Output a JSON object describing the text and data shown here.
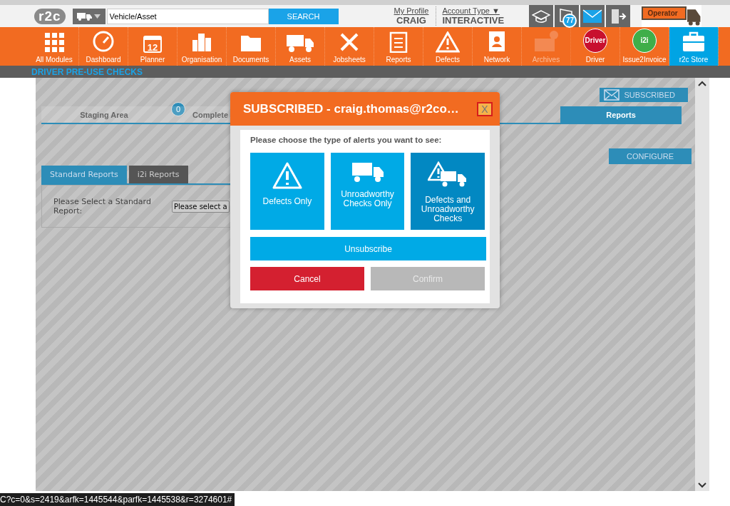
{
  "header": {
    "logo": "r2c",
    "search": {
      "value": "Vehicle/Asset",
      "button": "SEARCH"
    },
    "profile": {
      "link": "My Profile",
      "name": "CRAIG"
    },
    "account": {
      "link": "Account Type",
      "caret": "▼",
      "value": "INTERACTIVE"
    },
    "notification_count": "77",
    "operator": "Operator"
  },
  "nav": [
    {
      "label": "All Modules",
      "kind": "grid",
      "selected": false,
      "disabled": false
    },
    {
      "label": "Dashboard",
      "kind": "gauge",
      "selected": false,
      "disabled": false
    },
    {
      "label": "Planner",
      "kind": "calendar",
      "icon_text": "12",
      "selected": false,
      "disabled": false
    },
    {
      "label": "Organisation",
      "kind": "buildings",
      "selected": false,
      "disabled": false
    },
    {
      "label": "Documents",
      "kind": "folder",
      "selected": false,
      "disabled": false
    },
    {
      "label": "Assets",
      "kind": "truck",
      "selected": false,
      "disabled": false
    },
    {
      "label": "Jobsheets",
      "kind": "tools",
      "selected": false,
      "disabled": false
    },
    {
      "label": "Reports",
      "kind": "clipboard",
      "selected": false,
      "disabled": false
    },
    {
      "label": "Defects",
      "kind": "warning",
      "selected": false,
      "disabled": false
    },
    {
      "label": "Network",
      "kind": "contacts",
      "selected": false,
      "disabled": false
    },
    {
      "label": "Archives",
      "kind": "archive",
      "selected": false,
      "disabled": true
    },
    {
      "label": "Driver",
      "kind": "badge",
      "icon_text": "Driver",
      "color": "#c8102e",
      "selected": false,
      "disabled": false
    },
    {
      "label": "Issue2Invoice",
      "kind": "badge",
      "icon_text": "i2i",
      "color": "#3fae49",
      "selected": false,
      "disabled": false
    },
    {
      "label": "r2c Store",
      "kind": "briefcase",
      "selected": true,
      "disabled": false
    }
  ],
  "page_title": "DRIVER PRE-USE CHECKS",
  "subscribed_button": "SUBSCRIBED",
  "tabs": [
    {
      "label": "Staging Area",
      "badge": "0",
      "selected": false
    },
    {
      "label": "Complete",
      "selected": false
    },
    {
      "label": "Reports",
      "selected": true
    }
  ],
  "configure_button": "CONFIGURE",
  "report_tabs": [
    {
      "label": "Standard Reports",
      "selected": true
    },
    {
      "label": "i2i Reports",
      "selected": false
    }
  ],
  "report_select": {
    "label": "Please Select a Standard Report:",
    "value": "Please select a"
  },
  "modal": {
    "title": "SUBSCRIBED - craig.thomas@r2co…",
    "close": "X",
    "prompt": "Please choose the type of alerts you want to see:",
    "options": [
      {
        "label": "Defects Only",
        "kind": "warning",
        "selected": false
      },
      {
        "label": "Unroadworthy Checks Only",
        "kind": "truck",
        "selected": false
      },
      {
        "label": "Defects and Unroadworthy Checks",
        "kind": "warning-truck",
        "selected": true
      }
    ],
    "unsubscribe": "Unsubscribe",
    "cancel": "Cancel",
    "confirm": "Confirm"
  },
  "status_url": "C?c=0&s=2419&arfk=1445544&parfk=1445538&r=3274601#"
}
